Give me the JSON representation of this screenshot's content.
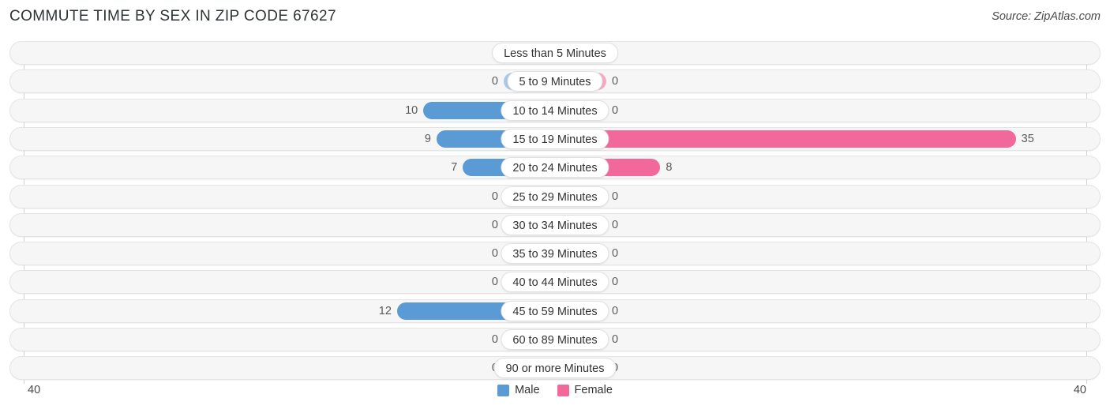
{
  "header": {
    "title": "COMMUTE TIME BY SEX IN ZIP CODE 67627",
    "source": "Source: ZipAtlas.com"
  },
  "axis": {
    "left_label": "40",
    "right_label": "40"
  },
  "legend": {
    "items": [
      {
        "label": "Male",
        "color": "#5b9bd5",
        "swatch_name": "legend-swatch-male"
      },
      {
        "label": "Female",
        "color": "#f2689b",
        "swatch_name": "legend-swatch-female"
      }
    ]
  },
  "colors": {
    "male": "#5b9bd5",
    "male_zero": "#a8c8e8",
    "female": "#f2689b",
    "female_zero": "#f7a8c4",
    "track": "#f6f6f6",
    "gridline": "#d3d3d3"
  },
  "chart_data": {
    "type": "bar",
    "title": "COMMUTE TIME BY SEX IN ZIP CODE 67627",
    "subtitle": "",
    "orientation": "horizontal-diverging",
    "xlabel": "",
    "ylabel": "",
    "xlim": [
      40,
      40
    ],
    "axis_max_left": 40,
    "axis_max_right": 40,
    "grid": true,
    "legend_position": "bottom-center",
    "categories": [
      "Less than 5 Minutes",
      "5 to 9 Minutes",
      "10 to 14 Minutes",
      "15 to 19 Minutes",
      "20 to 24 Minutes",
      "25 to 29 Minutes",
      "30 to 34 Minutes",
      "35 to 39 Minutes",
      "40 to 44 Minutes",
      "45 to 59 Minutes",
      "60 to 89 Minutes",
      "90 or more Minutes"
    ],
    "series": [
      {
        "name": "Male",
        "values": [
          0,
          0,
          10,
          9,
          7,
          0,
          0,
          0,
          0,
          12,
          0,
          0
        ]
      },
      {
        "name": "Female",
        "values": [
          0,
          0,
          0,
          35,
          8,
          0,
          0,
          0,
          0,
          0,
          0,
          0
        ]
      }
    ]
  },
  "rows": [
    {
      "label": "Less than 5 Minutes",
      "male": "0",
      "female": "0"
    },
    {
      "label": "5 to 9 Minutes",
      "male": "0",
      "female": "0"
    },
    {
      "label": "10 to 14 Minutes",
      "male": "10",
      "female": "0"
    },
    {
      "label": "15 to 19 Minutes",
      "male": "9",
      "female": "35"
    },
    {
      "label": "20 to 24 Minutes",
      "male": "7",
      "female": "8"
    },
    {
      "label": "25 to 29 Minutes",
      "male": "0",
      "female": "0"
    },
    {
      "label": "30 to 34 Minutes",
      "male": "0",
      "female": "0"
    },
    {
      "label": "35 to 39 Minutes",
      "male": "0",
      "female": "0"
    },
    {
      "label": "40 to 44 Minutes",
      "male": "0",
      "female": "0"
    },
    {
      "label": "45 to 59 Minutes",
      "male": "12",
      "female": "0"
    },
    {
      "label": "60 to 89 Minutes",
      "male": "0",
      "female": "0"
    },
    {
      "label": "90 or more Minutes",
      "male": "0",
      "female": "0"
    }
  ]
}
